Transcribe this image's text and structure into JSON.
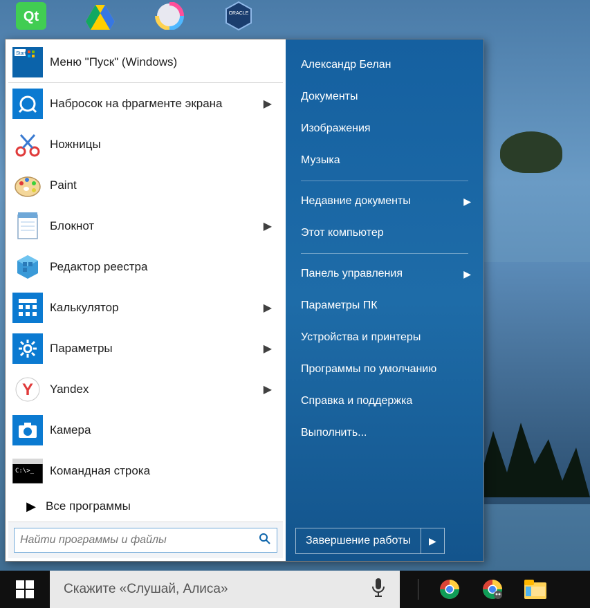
{
  "left_panel": {
    "top_item": {
      "label": "Меню \"Пуск\" (Windows)"
    },
    "items": [
      {
        "label": "Набросок на фрагменте экрана",
        "has_submenu": true,
        "icon": "snip-sketch-icon"
      },
      {
        "label": "Ножницы",
        "has_submenu": false,
        "icon": "scissors-icon"
      },
      {
        "label": "Paint",
        "has_submenu": false,
        "icon": "paint-icon"
      },
      {
        "label": "Блокнот",
        "has_submenu": true,
        "icon": "notepad-icon"
      },
      {
        "label": "Редактор реестра",
        "has_submenu": false,
        "icon": "regedit-icon"
      },
      {
        "label": "Калькулятор",
        "has_submenu": true,
        "icon": "calculator-icon"
      },
      {
        "label": "Параметры",
        "has_submenu": true,
        "icon": "settings-gear-icon"
      },
      {
        "label": "Yandex",
        "has_submenu": true,
        "icon": "yandex-icon"
      },
      {
        "label": "Камера",
        "has_submenu": false,
        "icon": "camera-icon"
      },
      {
        "label": "Командная строка",
        "has_submenu": false,
        "icon": "cmd-icon"
      }
    ],
    "all_programs": "Все программы",
    "search_placeholder": "Найти программы и файлы"
  },
  "right_panel": {
    "groups": [
      [
        {
          "label": "Александр Белан",
          "has_submenu": false
        },
        {
          "label": "Документы",
          "has_submenu": false
        },
        {
          "label": "Изображения",
          "has_submenu": false
        },
        {
          "label": "Музыка",
          "has_submenu": false
        }
      ],
      [
        {
          "label": "Недавние документы",
          "has_submenu": true
        },
        {
          "label": "Этот компьютер",
          "has_submenu": false
        }
      ],
      [
        {
          "label": "Панель управления",
          "has_submenu": true
        },
        {
          "label": "Параметры ПК",
          "has_submenu": false
        },
        {
          "label": "Устройства и принтеры",
          "has_submenu": false
        },
        {
          "label": "Программы по умолчанию",
          "has_submenu": false
        },
        {
          "label": "Справка и поддержка",
          "has_submenu": false
        },
        {
          "label": "Выполнить...",
          "has_submenu": false
        }
      ]
    ],
    "shutdown": "Завершение работы"
  },
  "taskbar": {
    "voice_placeholder": "Скажите «Слушай, Алиса»"
  },
  "colors": {
    "accent_blue": "#0b7ad1",
    "panel_blue": "#1e6ca8"
  }
}
